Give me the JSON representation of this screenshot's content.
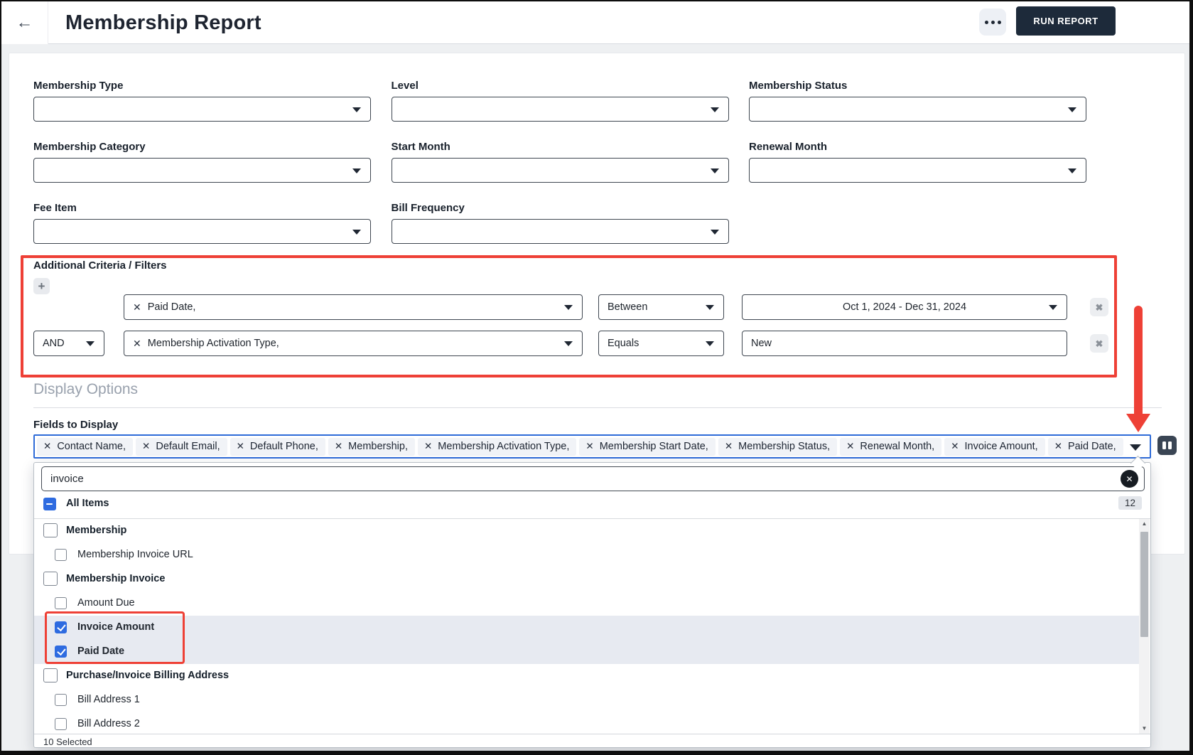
{
  "header": {
    "title": "Membership Report",
    "back_icon": "arrow-left",
    "more_icon": "ellipsis",
    "run_report_label": "RUN REPORT"
  },
  "filters": [
    {
      "label": "Membership Type",
      "value": ""
    },
    {
      "label": "Level",
      "value": ""
    },
    {
      "label": "Membership Status",
      "value": ""
    },
    {
      "label": "Membership Category",
      "value": ""
    },
    {
      "label": "Start Month",
      "value": ""
    },
    {
      "label": "Renewal Month",
      "value": ""
    },
    {
      "label": "Fee Item",
      "value": ""
    },
    {
      "label": "Bill Frequency",
      "value": ""
    }
  ],
  "criteria": {
    "section_label": "Additional Criteria / Filters",
    "add_button_icon": "plus",
    "remove_button_icon": "x-cross",
    "rows": [
      {
        "conjunction": "",
        "field": "Paid Date,",
        "operator": "Between",
        "value": "Oct 1, 2024 - Dec 31, 2024",
        "value_kind": "dropdown"
      },
      {
        "conjunction": "AND",
        "field": "Membership Activation Type,",
        "operator": "Equals",
        "value": "New",
        "value_kind": "input"
      }
    ]
  },
  "display_options": {
    "section_label": "Display Options",
    "fields_label": "Fields to Display",
    "chips": [
      "Contact Name,",
      "Default Email,",
      "Default Phone,",
      "Membership,",
      "Membership Activation Type,",
      "Membership Start Date,",
      "Membership Status,",
      "Renewal Month,",
      "Invoice Amount,",
      "Paid Date,"
    ],
    "column_picker_icon": "columns"
  },
  "dropdown": {
    "search_value": "invoice",
    "clear_icon": "circle-x",
    "all_items_label": "All Items",
    "count_badge": "12",
    "items": [
      {
        "label": "Membership",
        "level": 0,
        "checked": false,
        "highlighted": false
      },
      {
        "label": "Membership Invoice URL",
        "level": 1,
        "checked": false,
        "highlighted": false
      },
      {
        "label": "Membership Invoice",
        "level": 0,
        "checked": false,
        "highlighted": false
      },
      {
        "label": "Amount Due",
        "level": 1,
        "checked": false,
        "highlighted": false
      },
      {
        "label": "Invoice Amount",
        "level": 1,
        "checked": true,
        "highlighted": true
      },
      {
        "label": "Paid Date",
        "level": 1,
        "checked": true,
        "highlighted": true
      },
      {
        "label": "Purchase/Invoice Billing Address",
        "level": 0,
        "checked": false,
        "highlighted": false
      },
      {
        "label": "Bill Address 1",
        "level": 1,
        "checked": false,
        "highlighted": false
      },
      {
        "label": "Bill Address 2",
        "level": 1,
        "checked": false,
        "highlighted": false
      }
    ],
    "footer": "10 Selected"
  },
  "colors": {
    "accent_blue": "#2e6bd8",
    "check_blue": "#2e6be0",
    "annotation_red": "#ee4036",
    "navy_button": "#1d2a3a",
    "highlight_row": "#e7eaf1"
  }
}
